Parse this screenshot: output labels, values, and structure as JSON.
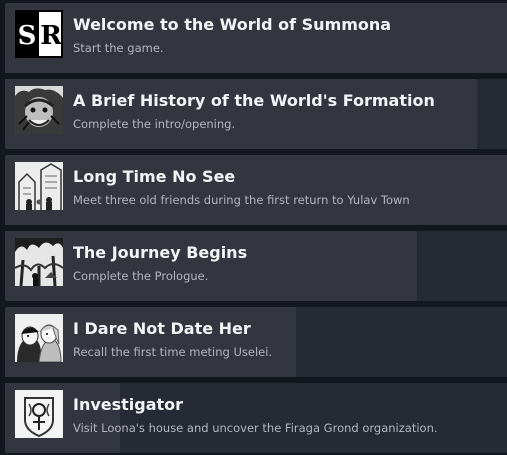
{
  "achievements": [
    {
      "title": "Welcome to the World of Summona",
      "description": "Start the game.",
      "progress": 1.0,
      "icon": "sr-logo-icon",
      "logo_text": "SR"
    },
    {
      "title": "A Brief History of the World's Formation",
      "description": "Complete the intro/opening.",
      "progress": 0.94,
      "icon": "face-sketch-icon"
    },
    {
      "title": "Long Time No See",
      "description": "Meet three old friends during the first return to Yulav Town",
      "progress": 1.0,
      "icon": "town-sketch-icon"
    },
    {
      "title": "The Journey Begins",
      "description": "Complete the Prologue.",
      "progress": 0.82,
      "icon": "forest-sketch-icon"
    },
    {
      "title": "I Dare Not Date Her",
      "description": "Recall the first time meting Uselei.",
      "progress": 0.58,
      "icon": "couple-sketch-icon"
    },
    {
      "title": "Investigator",
      "description": "Visit Loona's house and uncover the Firaga Grond organization.",
      "progress": 0.23,
      "icon": "crest-icon"
    }
  ],
  "colors": {
    "background": "#13171e",
    "row_base": "#262a35",
    "row_fill": "#33363f",
    "title": "#f3f4f6",
    "description": "#b3b6bf"
  }
}
